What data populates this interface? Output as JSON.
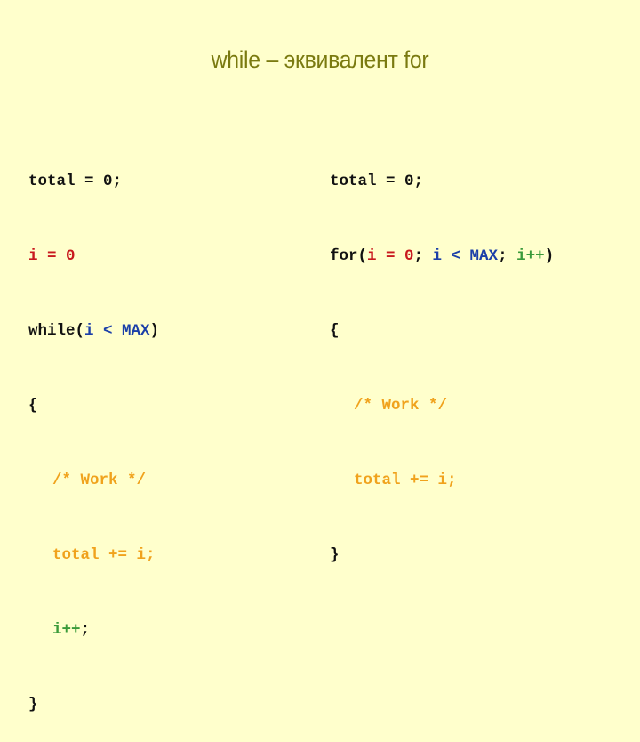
{
  "slide": {
    "title": "while – эквивалент for",
    "colors": {
      "background": "#ffffcc",
      "title": "#7a7a10",
      "code_default": "#111111",
      "init": "#c8191e",
      "condition": "#1b3fa8",
      "body": "#f0a21c",
      "increment": "#3a9a3a"
    },
    "left_code": {
      "line1": "total = 0;",
      "line2": "i = 0",
      "line3_kw": "while(",
      "line3_cond": "i < MAX",
      "line3_end": ")",
      "line4": "{",
      "line5": "/* Work */",
      "line6": "total += i;",
      "line7_inc": "i++",
      "line7_end": ";",
      "line8": "}"
    },
    "right_code": {
      "line1": "total = 0;",
      "line2_kw": "for(",
      "line2_init": "i = 0",
      "line2_sep1": "; ",
      "line2_cond": "i < MAX",
      "line2_sep2": "; ",
      "line2_inc": "i++",
      "line2_end": ")",
      "line3": "{",
      "line4": "/* Work */",
      "line5": "total += i;",
      "line6": "}"
    }
  }
}
